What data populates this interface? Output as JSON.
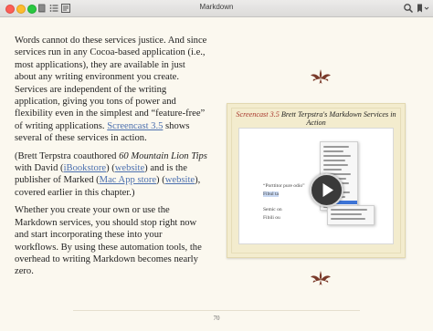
{
  "window": {
    "title": "Markdown"
  },
  "toolbar": {
    "icons": [
      "book-icon",
      "list-icon",
      "notes-icon",
      "search-icon",
      "bookmark-icon"
    ]
  },
  "body": {
    "p1": {
      "t1": "Words cannot do these services justice. And since services run in any Cocoa-based application (i.e., most applications), they are available in just about any writing environment you create. Services are independent of the writing application, giving you tons of power and flexibility even in the simplest and “feature-free” of writing applications. ",
      "link": "Screencast 3.5",
      "t2": " shows several of these services in action."
    },
    "p2": {
      "t1": "(Brett Terpstra coauthored ",
      "book": "60 Mountain Lion Tips",
      "t2": " with David (",
      "l1": "iBookstore",
      "t3": ") (",
      "l2": "website",
      "t4": ") and is the publisher of Marked (",
      "l3": "Mac App store",
      "t5": ") (",
      "l4": "website",
      "t6": "), covered earlier in this chapter.)"
    },
    "p3": "Whether you create your own or use the Markdown services, you should stop right now and start incorporating these into your workflows. By using these automation tools, the overhead to writing Markdown becomes nearly zero."
  },
  "figure": {
    "number": "Screencast 3.5",
    "title": " Brett Terpstra's Markdown Services in Action",
    "video_lines": [
      "“Porttitor pure odio”",
      "Fibul ta",
      "Semic on",
      "Fibili ou"
    ]
  },
  "page_number": "70",
  "colors": {
    "link": "#4b6fae",
    "caption_number": "#a8372d",
    "ornament": "#7a3a2a",
    "page": "#fbf8ef"
  }
}
